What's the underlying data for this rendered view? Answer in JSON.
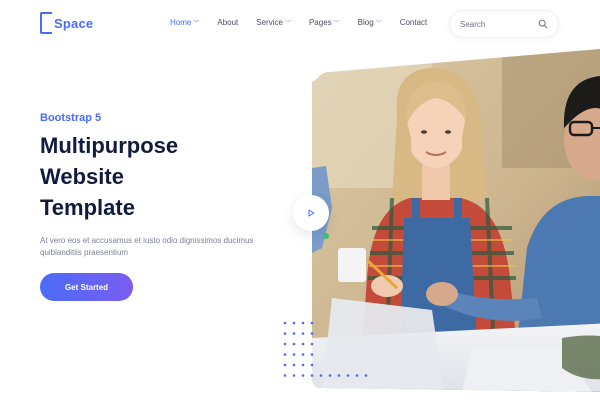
{
  "brand": {
    "name": "Space",
    "accent": "#4a6cf7"
  },
  "nav": {
    "items": [
      {
        "label": "Home",
        "has_dropdown": true,
        "active": true
      },
      {
        "label": "About",
        "has_dropdown": false,
        "active": false
      },
      {
        "label": "Service",
        "has_dropdown": true,
        "active": false
      },
      {
        "label": "Pages",
        "has_dropdown": true,
        "active": false
      },
      {
        "label": "Blog",
        "has_dropdown": true,
        "active": false
      },
      {
        "label": "Contact",
        "has_dropdown": false,
        "active": false
      }
    ]
  },
  "search": {
    "placeholder": "Search",
    "icon": "search-icon"
  },
  "hero": {
    "eyebrow": "Bootstrap 5",
    "title_lines": [
      "Multipurpose",
      "Website",
      "Template"
    ],
    "description": "At vero eos et accusamus et iusto odio dignissimos ducimus quiblanditiis praesentium",
    "cta_label": "Get Started",
    "cta_gradient": [
      "#4a6cf7",
      "#7b5cf0"
    ],
    "play_icon": "play-icon"
  },
  "colors": {
    "heading": "#121a3e",
    "body_text": "#7c8297",
    "nav_text": "#4b4f63"
  }
}
